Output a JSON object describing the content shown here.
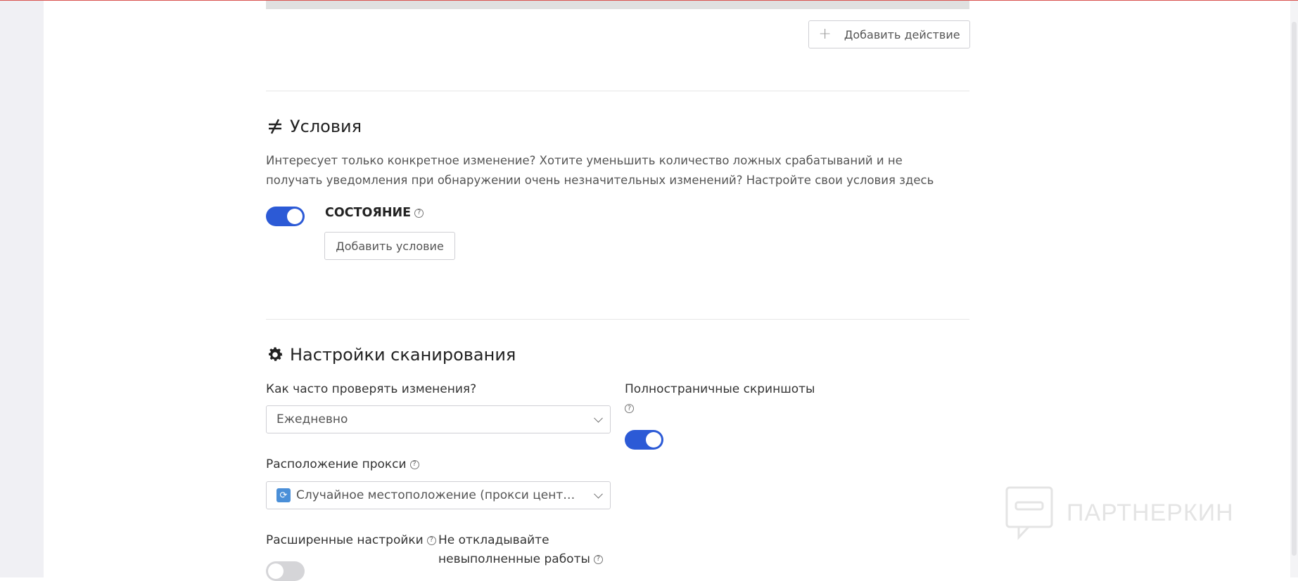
{
  "actions": {
    "add_action_label": "Добавить действие"
  },
  "conditions": {
    "title": "Условия",
    "icon": "not-equal-icon",
    "description": "Интересует только конкретное изменение? Хотите уменьшить количество ложных срабатываний и не получать уведомления при обнаружении очень незначительных изменений? Настройте свои условия здесь",
    "toggle_on": true,
    "toggle_label": "СОСТОЯНИЕ",
    "add_condition_label": "Добавить условие"
  },
  "scan_settings": {
    "title": "Настройки сканирования",
    "icon": "gear-icon",
    "frequency": {
      "label": "Как часто проверять изменения?",
      "value": "Ежедневно"
    },
    "fullpage_screenshots": {
      "label": "Полностраничные скриншоты",
      "toggle_on": true
    },
    "proxy": {
      "label": "Расположение прокси",
      "value": "Случайное местоположение (прокси центра обр..."
    },
    "advanced": {
      "label": "Расширенные настройки",
      "toggle_on": false
    },
    "no_delay": {
      "label_line1": "Не откладывайте",
      "label_line2": "невыполненные работы"
    }
  },
  "watermark": {
    "text": "ПАРТНЕРКИН"
  },
  "colors": {
    "accent": "#2c5ad6",
    "border": "#cfcfd4",
    "top_border": "#d9534f"
  }
}
